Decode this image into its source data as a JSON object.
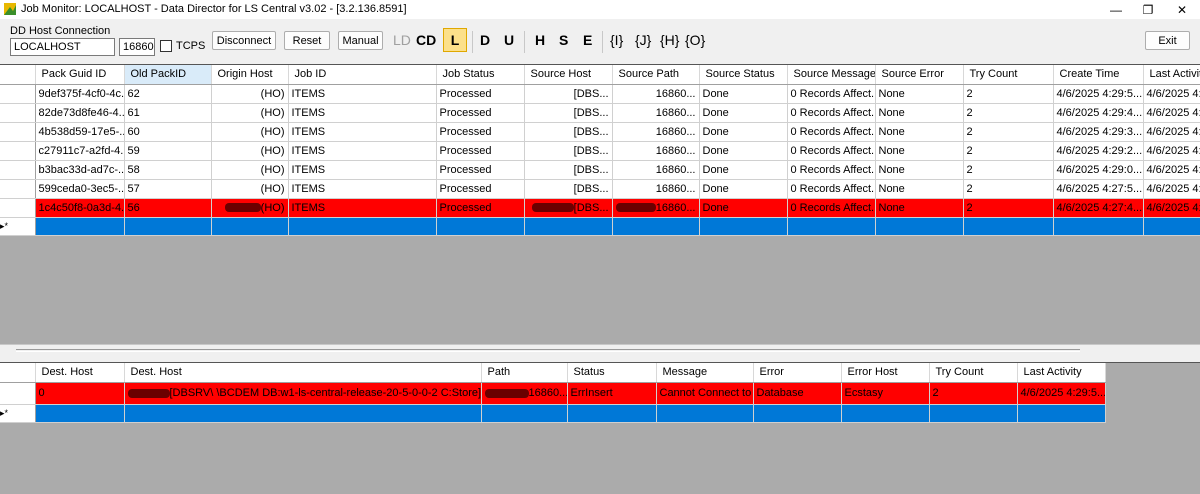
{
  "window": {
    "title": "Job Monitor: LOCALHOST - Data Director for LS Central v3.02 - [3.2.136.8591]",
    "minimize": "—",
    "restore": "❐",
    "close": "✕"
  },
  "connection": {
    "group_label": "DD Host Connection",
    "host_value": "LOCALHOST",
    "port_value": "16860",
    "tcps_label": "TCPS",
    "tcps_checked": false
  },
  "toolbar": {
    "disconnect_label": "Disconnect",
    "reset_label": "Reset",
    "manual_label": "Manual",
    "ld_label": "LD",
    "cd_label": "CD",
    "l_label": "L",
    "d_label": "D",
    "u_label": "U",
    "h_label": "H",
    "s_label": "S",
    "e_label": "E",
    "i_brace_label": "{I}",
    "j_brace_label": "{J}",
    "h_brace_label": "{H}",
    "o_brace_label": "{O}",
    "exit_label": "Exit"
  },
  "jobs_grid": {
    "columns": [
      "Pack Guid ID",
      "Old PackID",
      "Origin Host",
      "Job ID",
      "Job Status",
      "Source Host",
      "Source Path",
      "Source Status",
      "Source Message",
      "Source Error",
      "Try Count",
      "Create Time",
      "Last Activity"
    ],
    "rows": [
      {
        "guid": "9def375f-4cf0-4c...",
        "old_pack": "62",
        "origin": "(HO)",
        "job": "ITEMS",
        "status": "Processed",
        "src_host": "[DBS...",
        "src_path": "16860...",
        "src_status": "Done",
        "src_msg": "0 Records Affect...",
        "src_err": "None",
        "try": "2",
        "create": "4/6/2025 4:29:5...",
        "last": "4/6/2025 4:2"
      },
      {
        "guid": "82de73d8fe46-4...",
        "old_pack": "61",
        "origin": "(HO)",
        "job": "ITEMS",
        "status": "Processed",
        "src_host": "[DBS...",
        "src_path": "16860...",
        "src_status": "Done",
        "src_msg": "0 Records Affect...",
        "src_err": "None",
        "try": "2",
        "create": "4/6/2025 4:29:4...",
        "last": "4/6/2025 4:2"
      },
      {
        "guid": "4b538d59-17e5-...",
        "old_pack": "60",
        "origin": "(HO)",
        "job": "ITEMS",
        "status": "Processed",
        "src_host": "[DBS...",
        "src_path": "16860...",
        "src_status": "Done",
        "src_msg": "0 Records Affect...",
        "src_err": "None",
        "try": "2",
        "create": "4/6/2025 4:29:3...",
        "last": "4/6/2025 4:2"
      },
      {
        "guid": "c27911c7-a2fd-4...",
        "old_pack": "59",
        "origin": "(HO)",
        "job": "ITEMS",
        "status": "Processed",
        "src_host": "[DBS...",
        "src_path": "16860...",
        "src_status": "Done",
        "src_msg": "0 Records Affect...",
        "src_err": "None",
        "try": "2",
        "create": "4/6/2025 4:29:2...",
        "last": "4/6/2025 4:2"
      },
      {
        "guid": "b3bac33d-ad7c-...",
        "old_pack": "58",
        "origin": "(HO)",
        "job": "ITEMS",
        "status": "Processed",
        "src_host": "[DBS...",
        "src_path": "16860...",
        "src_status": "Done",
        "src_msg": "0 Records Affect...",
        "src_err": "None",
        "try": "2",
        "create": "4/6/2025 4:29:0...",
        "last": "4/6/2025 4:2"
      },
      {
        "guid": "599ceda0-3ec5-...",
        "old_pack": "57",
        "origin": "(HO)",
        "job": "ITEMS",
        "status": "Processed",
        "src_host": "[DBS...",
        "src_path": "16860...",
        "src_status": "Done",
        "src_msg": "0 Records Affect...",
        "src_err": "None",
        "try": "2",
        "create": "4/6/2025 4:27:5...",
        "last": "4/6/2025 4:2"
      },
      {
        "guid": "1c4c50f8-0a3d-4...",
        "old_pack": "56",
        "origin": "(HO)",
        "job": "ITEMS",
        "status": "Processed",
        "src_host": "[DBS...",
        "src_path": "16860...",
        "src_status": "Done",
        "src_msg": "0 Records Affect...",
        "src_err": "None",
        "try": "2",
        "create": "4/6/2025 4:27:4...",
        "last": "4/6/2025 4:2"
      }
    ],
    "new_row_marker": "▸*"
  },
  "dest_grid": {
    "columns": [
      "Dest. Host",
      "Dest. Host",
      "Path",
      "Status",
      "Message",
      "Error",
      "Error Host",
      "Try Count",
      "Last Activity"
    ],
    "rows": [
      {
        "dest_id": "0",
        "dest_host": "[DBSRV\\          \\BCDEM DB:w1-ls-central-release-20-5-0-0-2 C:Store]",
        "path": "16860...",
        "status": "ErrInsert",
        "message": "Cannot Connect to ...",
        "error": "Database",
        "error_host": "Ecstasy",
        "try": "2",
        "last": "4/6/2025 4:29:5..."
      }
    ],
    "new_row_marker": "▸*"
  },
  "colors": {
    "error_row": "#ff0000",
    "new_row": "#0078d7",
    "grid_background": "#ababab",
    "selected_toggle": "#fce08a"
  }
}
